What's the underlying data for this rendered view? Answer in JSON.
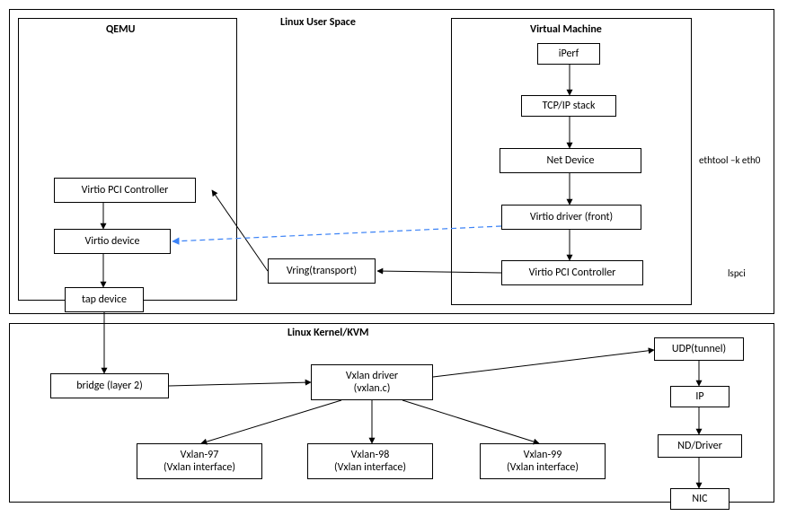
{
  "sections": {
    "userspace": "Linux User Space",
    "qemu": "QEMU",
    "vm": "Virtual Machine",
    "kernel": "Linux Kernel/KVM"
  },
  "boxes": {
    "virtio_pci_ctrl_qemu": "Virtio PCI Controller",
    "virtio_device": "Virtio device",
    "tap_device": "tap device",
    "vring": "Vring(transport)",
    "iperf": "iPerf",
    "tcpip": "TCP/IP stack",
    "net_device": "Net Device",
    "virtio_driver": "Virtio driver (front)",
    "virtio_pci_ctrl_vm": "Virtio PCI Controller",
    "bridge": "bridge (layer 2)",
    "vxlan_driver": "Vxlan driver\n(vxlan.c)",
    "vxlan97": "Vxlan-97\n(Vxlan interface)",
    "vxlan98": "Vxlan-98\n(Vxlan interface)",
    "vxlan99": "Vxlan-99\n(Vxlan interface)",
    "udp": "UDP(tunnel)",
    "ip": "IP",
    "nd_driver": "ND/Driver",
    "nic": "NIC"
  },
  "annotations": {
    "ethtool": "ethtool –k eth0",
    "lspci": "lspci"
  },
  "chart_data": {
    "type": "diagram",
    "title": "QEMU/KVM Virtio + VXLAN networking stack",
    "nodes": [
      {
        "id": "userspace",
        "label": "Linux User Space",
        "type": "section"
      },
      {
        "id": "qemu",
        "label": "QEMU",
        "type": "section",
        "parent": "userspace"
      },
      {
        "id": "vm",
        "label": "Virtual Machine",
        "type": "section",
        "parent": "userspace"
      },
      {
        "id": "kernel",
        "label": "Linux Kernel/KVM",
        "type": "section"
      },
      {
        "id": "virtio_pci_ctrl_qemu",
        "label": "Virtio PCI Controller",
        "parent": "qemu"
      },
      {
        "id": "virtio_device",
        "label": "Virtio device",
        "parent": "qemu"
      },
      {
        "id": "tap_device",
        "label": "tap device",
        "parent": "qemu"
      },
      {
        "id": "vring",
        "label": "Vring(transport)",
        "parent": "userspace"
      },
      {
        "id": "iperf",
        "label": "iPerf",
        "parent": "vm"
      },
      {
        "id": "tcpip",
        "label": "TCP/IP stack",
        "parent": "vm"
      },
      {
        "id": "net_device",
        "label": "Net Device",
        "parent": "vm",
        "annotation": "ethtool –k eth0"
      },
      {
        "id": "virtio_driver",
        "label": "Virtio driver (front)",
        "parent": "vm"
      },
      {
        "id": "virtio_pci_ctrl_vm",
        "label": "Virtio PCI Controller",
        "parent": "vm",
        "annotation": "lspci"
      },
      {
        "id": "bridge",
        "label": "bridge (layer 2)",
        "parent": "kernel"
      },
      {
        "id": "vxlan_driver",
        "label": "Vxlan driver (vxlan.c)",
        "parent": "kernel"
      },
      {
        "id": "vxlan97",
        "label": "Vxlan-97 (Vxlan interface)",
        "parent": "kernel"
      },
      {
        "id": "vxlan98",
        "label": "Vxlan-98 (Vxlan interface)",
        "parent": "kernel"
      },
      {
        "id": "vxlan99",
        "label": "Vxlan-99 (Vxlan interface)",
        "parent": "kernel"
      },
      {
        "id": "udp",
        "label": "UDP(tunnel)",
        "parent": "kernel"
      },
      {
        "id": "ip",
        "label": "IP",
        "parent": "kernel"
      },
      {
        "id": "nd_driver",
        "label": "ND/Driver",
        "parent": "kernel"
      },
      {
        "id": "nic",
        "label": "NIC",
        "parent": "kernel"
      }
    ],
    "edges": [
      {
        "from": "virtio_pci_ctrl_qemu",
        "to": "virtio_device"
      },
      {
        "from": "virtio_device",
        "to": "tap_device"
      },
      {
        "from": "vring",
        "to": "virtio_device"
      },
      {
        "from": "virtio_driver",
        "to": "virtio_device",
        "style": "dashed"
      },
      {
        "from": "iperf",
        "to": "tcpip"
      },
      {
        "from": "tcpip",
        "to": "net_device"
      },
      {
        "from": "net_device",
        "to": "virtio_driver"
      },
      {
        "from": "virtio_driver",
        "to": "virtio_pci_ctrl_vm"
      },
      {
        "from": "virtio_pci_ctrl_vm",
        "to": "vring"
      },
      {
        "from": "tap_device",
        "to": "bridge"
      },
      {
        "from": "bridge",
        "to": "vxlan_driver"
      },
      {
        "from": "vxlan_driver",
        "to": "vxlan97"
      },
      {
        "from": "vxlan_driver",
        "to": "vxlan98"
      },
      {
        "from": "vxlan_driver",
        "to": "vxlan99"
      },
      {
        "from": "vxlan_driver",
        "to": "udp"
      },
      {
        "from": "udp",
        "to": "ip"
      },
      {
        "from": "ip",
        "to": "nd_driver"
      },
      {
        "from": "nd_driver",
        "to": "nic"
      }
    ]
  }
}
